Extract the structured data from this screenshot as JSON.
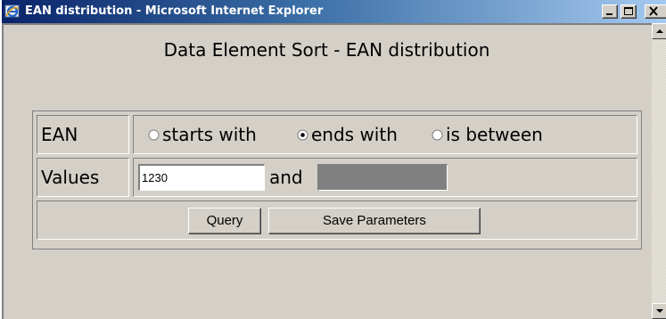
{
  "window": {
    "title": "EAN distribution - Microsoft Internet Explorer",
    "app_icon": "ie-icon",
    "controls": [
      "minimize-icon",
      "maximize-icon",
      "close-icon"
    ]
  },
  "page": {
    "heading": "Data Element Sort - EAN distribution"
  },
  "form": {
    "ean_row": {
      "label": "EAN",
      "options": [
        {
          "label": "starts with",
          "selected": false
        },
        {
          "label": "ends with",
          "selected": true
        },
        {
          "label": "is between",
          "selected": false
        }
      ]
    },
    "values_row": {
      "label": "Values",
      "value1": "1230",
      "connector": "and",
      "value2": ""
    },
    "buttons": {
      "query": "Query",
      "save": "Save Parameters"
    }
  },
  "scrollbar": {
    "up_icon": "arrow-up-icon",
    "down_icon": "arrow-down-icon"
  }
}
